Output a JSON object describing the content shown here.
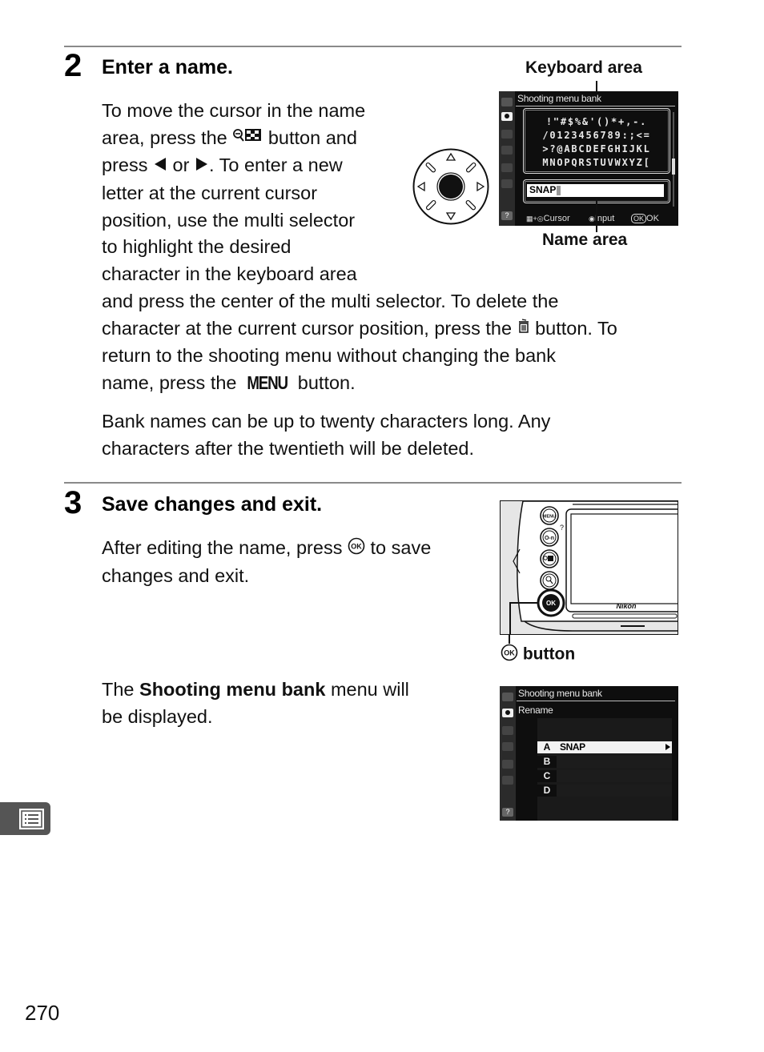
{
  "page_number": "270",
  "chapter_tab_icon": "menu-list-icon",
  "steps": [
    {
      "number": "2",
      "title": "Enter a name.",
      "paragraph1_lines": [
        "To move the cursor in the name",
        [
          "area, press the ",
          "{zoom-out-thumbnail-icon}",
          " button and"
        ],
        [
          "press ",
          "{left-arrow}",
          " or ",
          "{right-arrow}",
          ".  To enter a new"
        ],
        "letter at the current cursor",
        "position, use the multi selector",
        "to highlight the desired",
        "character in the keyboard area",
        "and press the center of the multi selector.  To delete the",
        [
          "character at the current cursor position, press the ",
          "{trash-icon}",
          " button.  To"
        ],
        "return to the shooting menu without changing the bank",
        [
          "name, press the ",
          "{MENU}",
          " button."
        ]
      ],
      "text": {
        "l1": "To move the cursor in the name",
        "l2a": "area, press the ",
        "l2b": " button and",
        "l3a": "press ",
        "l3b": " or ",
        "l3c": ".  To enter a new",
        "l4": "letter at the current cursor",
        "l5": "position, use the multi selector",
        "l6": "to highlight the desired",
        "l7": "character in the keyboard area",
        "l8": "and press the center of the multi selector.  To delete the",
        "l9a": "character at the current cursor position, press the ",
        "l9b": " button.  To",
        "l10": "return to the shooting menu without changing the bank",
        "l11a": "name, press the ",
        "l11menu": "MENU",
        "l11b": " button."
      },
      "paragraph2_lines": {
        "l1": "Bank names can be up to twenty characters long.  Any",
        "l2": "characters after the twentieth will be deleted."
      },
      "figure": {
        "keyboard_area_label": "Keyboard area",
        "name_area_label": "Name area",
        "screen": {
          "title": "Shooting menu bank",
          "keyboard_rows": [
            "!\"#$%&'()*+,-.",
            "/0123456789:;<=",
            ">?@ABCDEFGHIJKL",
            "MNOPQRSTUVWXYZ["
          ],
          "highlighted_key": "P",
          "name_value": "SNAP",
          "footer": {
            "cursor": "Cursor",
            "input": "Input",
            "ok": "OK",
            "ok_button": "OK"
          }
        }
      }
    },
    {
      "number": "3",
      "title": "Save changes and exit.",
      "text": {
        "l1a": "After editing the name, press ",
        "l1b": " to save",
        "l2": "changes and exit."
      },
      "camera_figure": {
        "button_labels": [
          "MENU",
          "O-n",
          "zoom-out",
          "zoom-in",
          "OK"
        ],
        "brand": "Nikon",
        "caption": "button",
        "caption_icon": "ok-button-icon"
      },
      "result_text": {
        "l1a": "The ",
        "l1bold": "Shooting menu bank",
        "l1b": " menu will",
        "l2": "be displayed."
      },
      "result_screen": {
        "title": "Shooting menu bank",
        "subtitle": "Rename",
        "rows": [
          {
            "letter": "A",
            "value": "SNAP",
            "selected": true
          },
          {
            "letter": "B",
            "value": "",
            "selected": false
          },
          {
            "letter": "C",
            "value": "",
            "selected": false
          },
          {
            "letter": "D",
            "value": "",
            "selected": false
          }
        ]
      }
    }
  ]
}
